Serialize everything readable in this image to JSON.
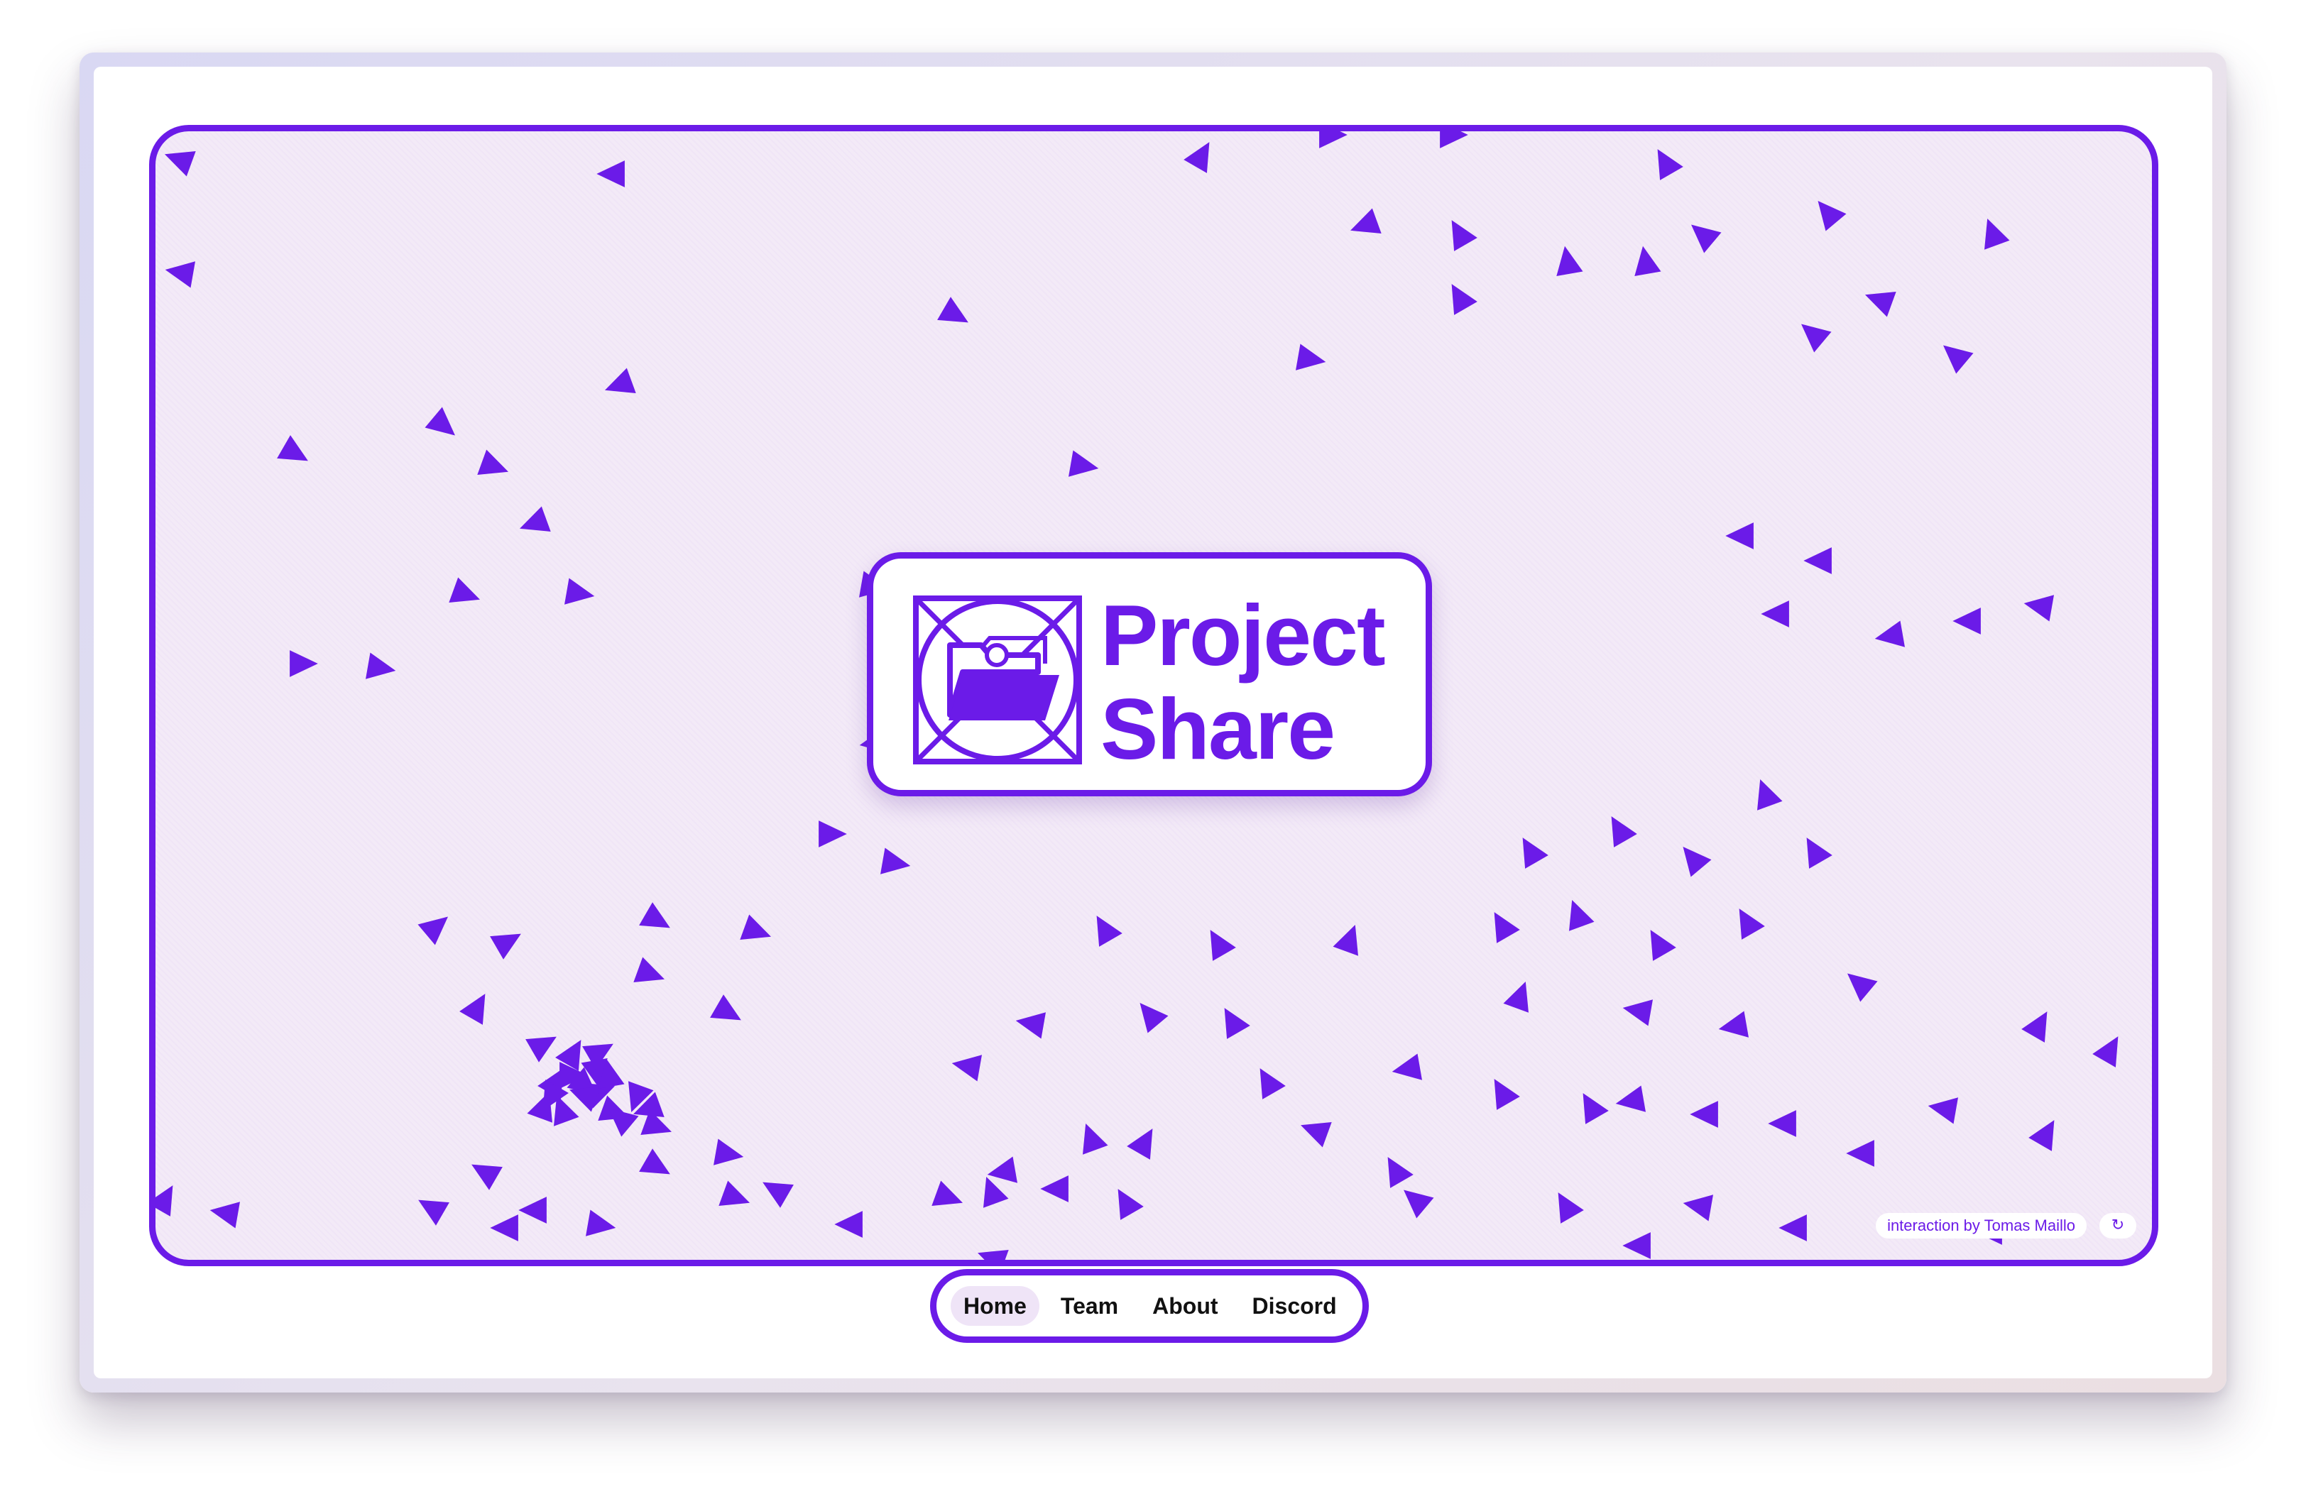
{
  "brand": {
    "title_line1": "Project",
    "title_line2": "Share",
    "logo_icon": "folder-icon",
    "accent_color": "#6b1be8"
  },
  "hero": {
    "background_color": "#f3eaf7",
    "credit": "interaction by Tomas Maillo",
    "reload_icon": "↻"
  },
  "nav": {
    "items": [
      {
        "label": "Home",
        "active": true
      },
      {
        "label": "Team",
        "active": false
      },
      {
        "label": "About",
        "active": false
      },
      {
        "label": "Discord",
        "active": false
      }
    ]
  }
}
